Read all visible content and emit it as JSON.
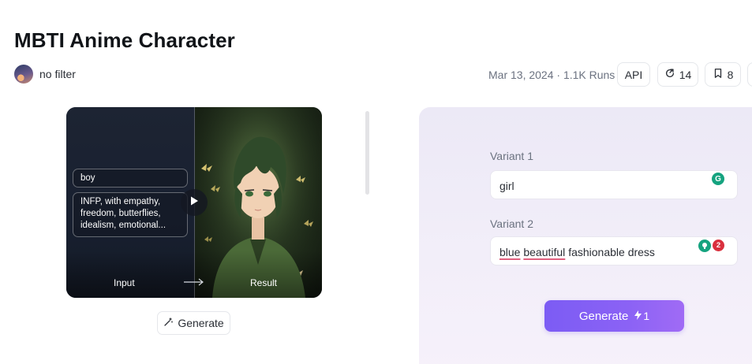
{
  "page": {
    "title": "MBTI Anime Character"
  },
  "author": {
    "name": "no filter"
  },
  "meta": {
    "text": "Mar 13, 2024 · 1.1K Runs"
  },
  "actions": {
    "api_label": "API",
    "share_count": "14",
    "save_count": "8"
  },
  "preview": {
    "tag_1": "boy",
    "tag_2": "INFP, with empathy,\nfreedom, butterflies,\nidealism, emotional...",
    "input_label": "Input",
    "result_label": "Result",
    "generate_label": "Generate"
  },
  "form": {
    "variant_1": {
      "label": "Variant 1",
      "value": "girl"
    },
    "variant_2": {
      "label": "Variant 2",
      "value_word_1": "blue",
      "value_word_2": "beautiful",
      "value_rest": "fashionable dress"
    },
    "grammarly_issue_count": "2",
    "generate_label": "Generate",
    "generate_cost": "1"
  },
  "colors": {
    "accent": "#7c5cf4",
    "grammarly": "#15a37f",
    "error_badge": "#d9303e"
  }
}
